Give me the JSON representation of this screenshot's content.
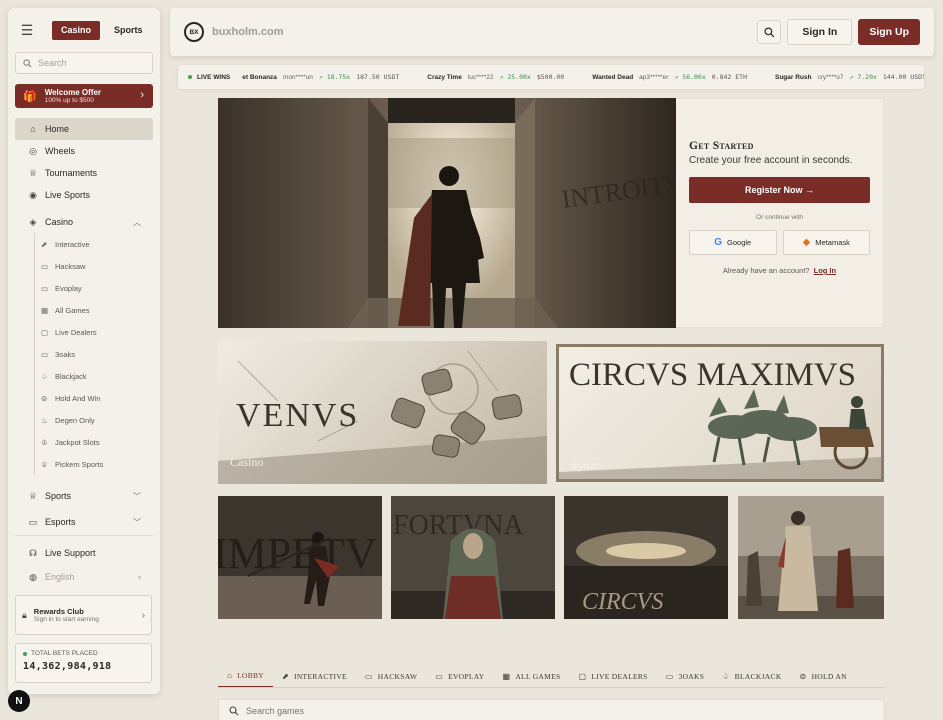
{
  "sidebar": {
    "tabs": [
      "Casino",
      "Sports"
    ],
    "search_placeholder": "Search",
    "welcome": {
      "title": "Welcome Offer",
      "subtitle": "100% up to $500"
    },
    "nav": [
      {
        "label": "Home",
        "icon": "home-icon"
      },
      {
        "label": "Wheels",
        "icon": "wheel-icon"
      },
      {
        "label": "Tournaments",
        "icon": "trophy-icon"
      },
      {
        "label": "Live Sports",
        "icon": "live-icon"
      }
    ],
    "casino_label": "Casino",
    "casino_sub": [
      "Interactive",
      "Hacksaw",
      "Evoplay",
      "All Games",
      "Live Dealers",
      "3oaks",
      "Blackjack",
      "Hold And Win",
      "Degen Only",
      "Jackpot Slots",
      "Pickem Sports"
    ],
    "sports_label": "Sports",
    "esports_label": "Esports",
    "live_support": "Live Support",
    "language": "English",
    "rewards": {
      "title": "Rewards Club",
      "subtitle": "Sign in to start earning"
    },
    "total_bets": {
      "label": "TOTAL BETS PLACED",
      "value": "14,362,984,918"
    }
  },
  "header": {
    "logo_text": "BX",
    "domain": "buxholm.com",
    "signin": "Sign In",
    "signup": "Sign Up"
  },
  "ticker": {
    "label": "LIVE WINS",
    "items": [
      {
        "game": "et Bonanza",
        "user": "mon****un",
        "mult": "18.75x",
        "amount": "187.50 USDT"
      },
      {
        "game": "Crazy Time",
        "user": "luc****22",
        "mult": "25.00x",
        "amount": "$500.00"
      },
      {
        "game": "Wanted Dead",
        "user": "ap3*****er",
        "mult": "56.00x",
        "amount": "0.842 ETH"
      },
      {
        "game": "Sugar Rush",
        "user": "cry****o7",
        "mult": "7.20x",
        "amount": "144.00 USDT"
      }
    ]
  },
  "hero": {
    "inscription": "INTROITVS"
  },
  "get_started": {
    "title": "Get Started",
    "subtitle": "Create your free account in seconds.",
    "register": "Register Now",
    "or": "Or continue with",
    "google": "Google",
    "metamask": "Metamask",
    "already": "Already have an account?",
    "login": "Log In"
  },
  "banners": {
    "venus": {
      "title": "VENVS",
      "tag": "Casino"
    },
    "circus": {
      "title": "CIRCVS MAXIMVS",
      "tag": "Sports"
    }
  },
  "tiles": [
    "IMPETV",
    "FORTVNA",
    "CIRCVS",
    ""
  ],
  "game_tabs": [
    {
      "label": "LOBBY",
      "icon": "home-icon"
    },
    {
      "label": "INTERACTIVE",
      "icon": "interactive-icon"
    },
    {
      "label": "HACKSAW",
      "icon": "gamepad-icon"
    },
    {
      "label": "EVOPLAY",
      "icon": "gamepad-icon"
    },
    {
      "label": "ALL GAMES",
      "icon": "grid-icon"
    },
    {
      "label": "LIVE DEALERS",
      "icon": "video-icon"
    },
    {
      "label": "3OAKS",
      "icon": "gamepad-icon"
    },
    {
      "label": "BLACKJACK",
      "icon": "spade-icon"
    },
    {
      "label": "HOLD AN",
      "icon": "coins-icon"
    }
  ],
  "game_search_placeholder": "Search games",
  "colors": {
    "accent": "#7a2d26",
    "background": "#ebe6dc",
    "panel": "#f4f1ea",
    "win_green": "#3f8a52"
  }
}
